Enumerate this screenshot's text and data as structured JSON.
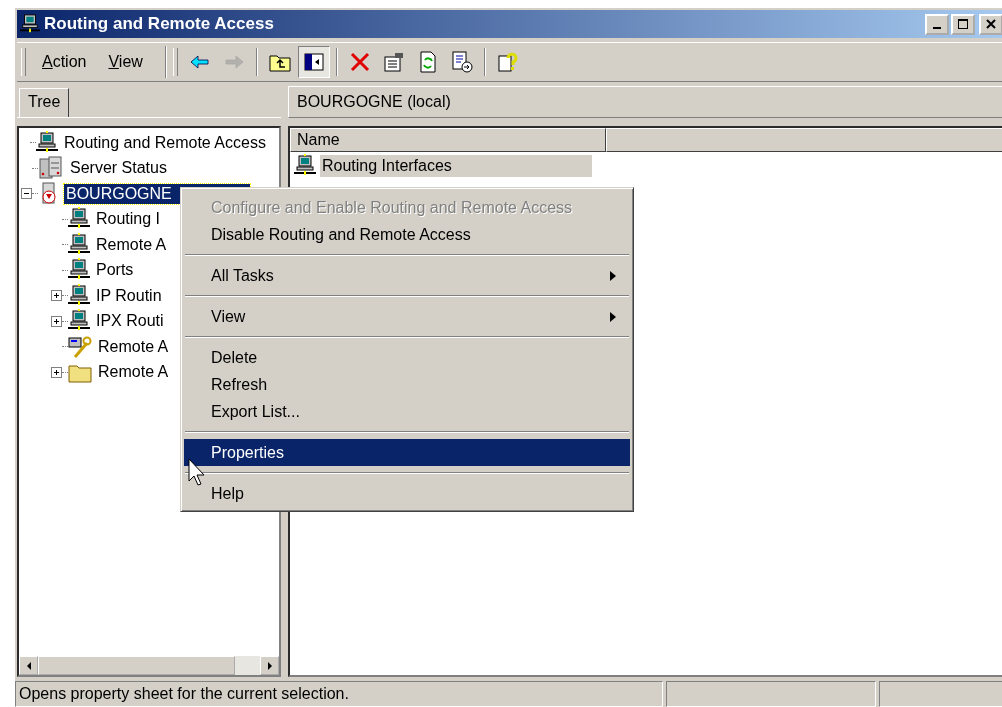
{
  "window": {
    "title": "Routing and Remote Access"
  },
  "menubar": [
    {
      "label": "Action"
    },
    {
      "label": "View"
    }
  ],
  "toolbar": [
    {
      "kind": "back",
      "disabled": false,
      "pressed": false
    },
    {
      "kind": "forward",
      "disabled": true,
      "pressed": false
    },
    {
      "kind": "up",
      "disabled": false,
      "pressed": false
    },
    {
      "kind": "tree",
      "disabled": false,
      "pressed": true
    },
    {
      "kind": "delete",
      "disabled": false,
      "pressed": false
    },
    {
      "kind": "properties",
      "disabled": false,
      "pressed": false
    },
    {
      "kind": "refresh",
      "disabled": false,
      "pressed": false
    },
    {
      "kind": "export",
      "disabled": false,
      "pressed": false
    },
    {
      "kind": "help",
      "disabled": false,
      "pressed": false
    }
  ],
  "tree": {
    "tab": "Tree",
    "nodes": [
      {
        "label": "Routing and Remote Access",
        "kind": "computer",
        "selected": false,
        "children": [
          {
            "label": "Server Status",
            "kind": "server",
            "selected": false
          },
          {
            "label": "BOURGOGNE",
            "kind": "server-alert",
            "selected": true,
            "expanded": true,
            "children": [
              {
                "label": "Routing I",
                "kind": "computer",
                "selected": false
              },
              {
                "label": "Remote A",
                "kind": "computer",
                "selected": false
              },
              {
                "label": "Ports",
                "kind": "computer",
                "selected": false
              },
              {
                "label": "IP Routin",
                "kind": "computer",
                "selected": false,
                "expanded": false
              },
              {
                "label": "IPX Routi",
                "kind": "computer",
                "selected": false,
                "expanded": false
              },
              {
                "label": "Remote A",
                "kind": "tool",
                "selected": false
              },
              {
                "label": "Remote A",
                "kind": "folder",
                "selected": false,
                "expanded": false
              }
            ]
          }
        ]
      }
    ]
  },
  "details": {
    "heading": "BOURGOGNE (local)",
    "columns": [
      "Name"
    ],
    "rows": [
      {
        "name": "Routing Interfaces",
        "selected": true
      }
    ]
  },
  "context_menu": [
    {
      "kind": "item",
      "label": "Configure and Enable Routing and Remote Access",
      "disabled": true,
      "submenu": false,
      "selected": false
    },
    {
      "kind": "item",
      "label": "Disable Routing and Remote Access",
      "disabled": false,
      "submenu": false,
      "selected": false
    },
    {
      "kind": "separator"
    },
    {
      "kind": "item",
      "label": "All Tasks",
      "disabled": false,
      "submenu": true,
      "selected": false
    },
    {
      "kind": "separator"
    },
    {
      "kind": "item",
      "label": "View",
      "disabled": false,
      "submenu": true,
      "selected": false
    },
    {
      "kind": "separator"
    },
    {
      "kind": "item",
      "label": "Delete",
      "disabled": false,
      "submenu": false,
      "selected": false
    },
    {
      "kind": "item",
      "label": "Refresh",
      "disabled": false,
      "submenu": false,
      "selected": false
    },
    {
      "kind": "item",
      "label": "Export List...",
      "disabled": false,
      "submenu": false,
      "selected": false
    },
    {
      "kind": "separator"
    },
    {
      "kind": "item",
      "label": "Properties",
      "disabled": false,
      "submenu": false,
      "selected": true
    },
    {
      "kind": "separator"
    },
    {
      "kind": "item",
      "label": "Help",
      "disabled": false,
      "submenu": false,
      "selected": false
    }
  ],
  "status_bar": {
    "text": "Opens property sheet for the current selection."
  }
}
